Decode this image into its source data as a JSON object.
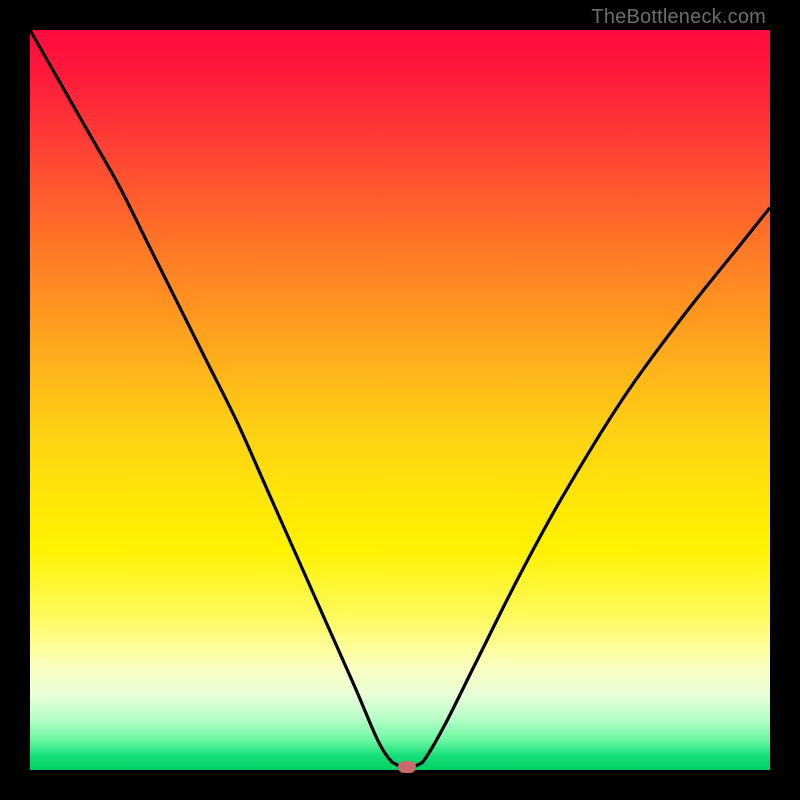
{
  "watermark": "TheBottleneck.com",
  "colors": {
    "curve_stroke": "#000000",
    "marker_fill": "#c96b6b",
    "frame_bg": "#000000"
  },
  "chart_data": {
    "type": "line",
    "title": "",
    "xlabel": "",
    "ylabel": "",
    "xlim": [
      0,
      100
    ],
    "ylim": [
      0,
      100
    ],
    "grid": false,
    "legend": false,
    "annotations": [
      {
        "type": "marker",
        "x": 51,
        "y": 0,
        "shape": "pill",
        "color": "#c96b6b"
      }
    ],
    "series": [
      {
        "name": "bottleneck-curve",
        "x": [
          0,
          4,
          8,
          12,
          16,
          20,
          24,
          28,
          32,
          36,
          40,
          44,
          47,
          49,
          51,
          53,
          56,
          60,
          66,
          72,
          80,
          88,
          96,
          100
        ],
        "y": [
          100,
          93,
          86,
          79,
          71,
          63,
          55,
          47,
          38,
          29,
          20,
          11,
          4,
          1,
          0,
          1,
          6,
          14,
          26,
          37,
          50,
          61,
          71,
          76
        ]
      }
    ],
    "background_gradient": {
      "direction": "vertical",
      "stops": [
        {
          "pos": 0.0,
          "hex": "#ff0a3e"
        },
        {
          "pos": 0.3,
          "hex": "#ff7a26"
        },
        {
          "pos": 0.62,
          "hex": "#ffe40a"
        },
        {
          "pos": 0.86,
          "hex": "#fcffc0"
        },
        {
          "pos": 1.0,
          "hex": "#00cf63"
        }
      ]
    }
  }
}
